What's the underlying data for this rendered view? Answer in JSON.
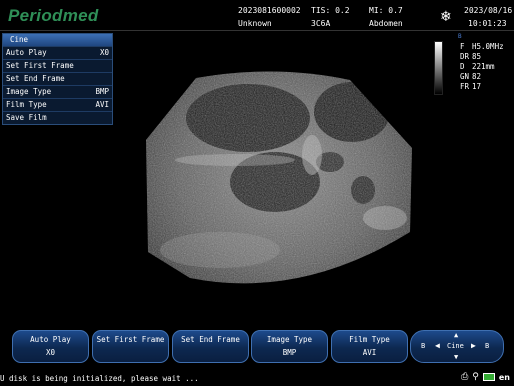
{
  "header": {
    "logo": "Periodmed",
    "patient_id": "2023081600002",
    "patient_name": "Unknown",
    "tis": "TIS: 0.2",
    "mi": "MI: 0.7",
    "probe": "3C6A",
    "exam": "Abdomen",
    "date": "2023/08/16",
    "time": "10:01:23",
    "freeze_icon": "snowflake-icon"
  },
  "menu": {
    "title": "Cine",
    "items": [
      {
        "label": "Auto Play",
        "value": "X0"
      },
      {
        "label": "Set First Frame",
        "value": ""
      },
      {
        "label": "Set End Frame",
        "value": ""
      },
      {
        "label": "Image Type",
        "value": "BMP"
      },
      {
        "label": "Film Type",
        "value": "AVI"
      },
      {
        "label": "Save Film",
        "value": ""
      }
    ]
  },
  "params": {
    "mode_mark": "B",
    "f": {
      "key": "F",
      "value": "H5.0MHz"
    },
    "dr": {
      "key": "DR",
      "value": "85"
    },
    "d": {
      "key": "D",
      "value": "221mm"
    },
    "gn": {
      "key": "GN",
      "value": "82"
    },
    "fr": {
      "key": "FR",
      "value": "17"
    }
  },
  "softkeys": [
    {
      "label": "Auto Play",
      "value": "X0"
    },
    {
      "label": "Set First Frame",
      "value": ""
    },
    {
      "label": "Set End Frame",
      "value": ""
    },
    {
      "label": "Image Type",
      "value": "BMP"
    },
    {
      "label": "Film Type",
      "value": "AVI"
    }
  ],
  "nav": {
    "center": "Cine",
    "left": "B",
    "right": "B"
  },
  "status": {
    "message": "U disk is being initialized, please wait ...",
    "lang": "en"
  }
}
